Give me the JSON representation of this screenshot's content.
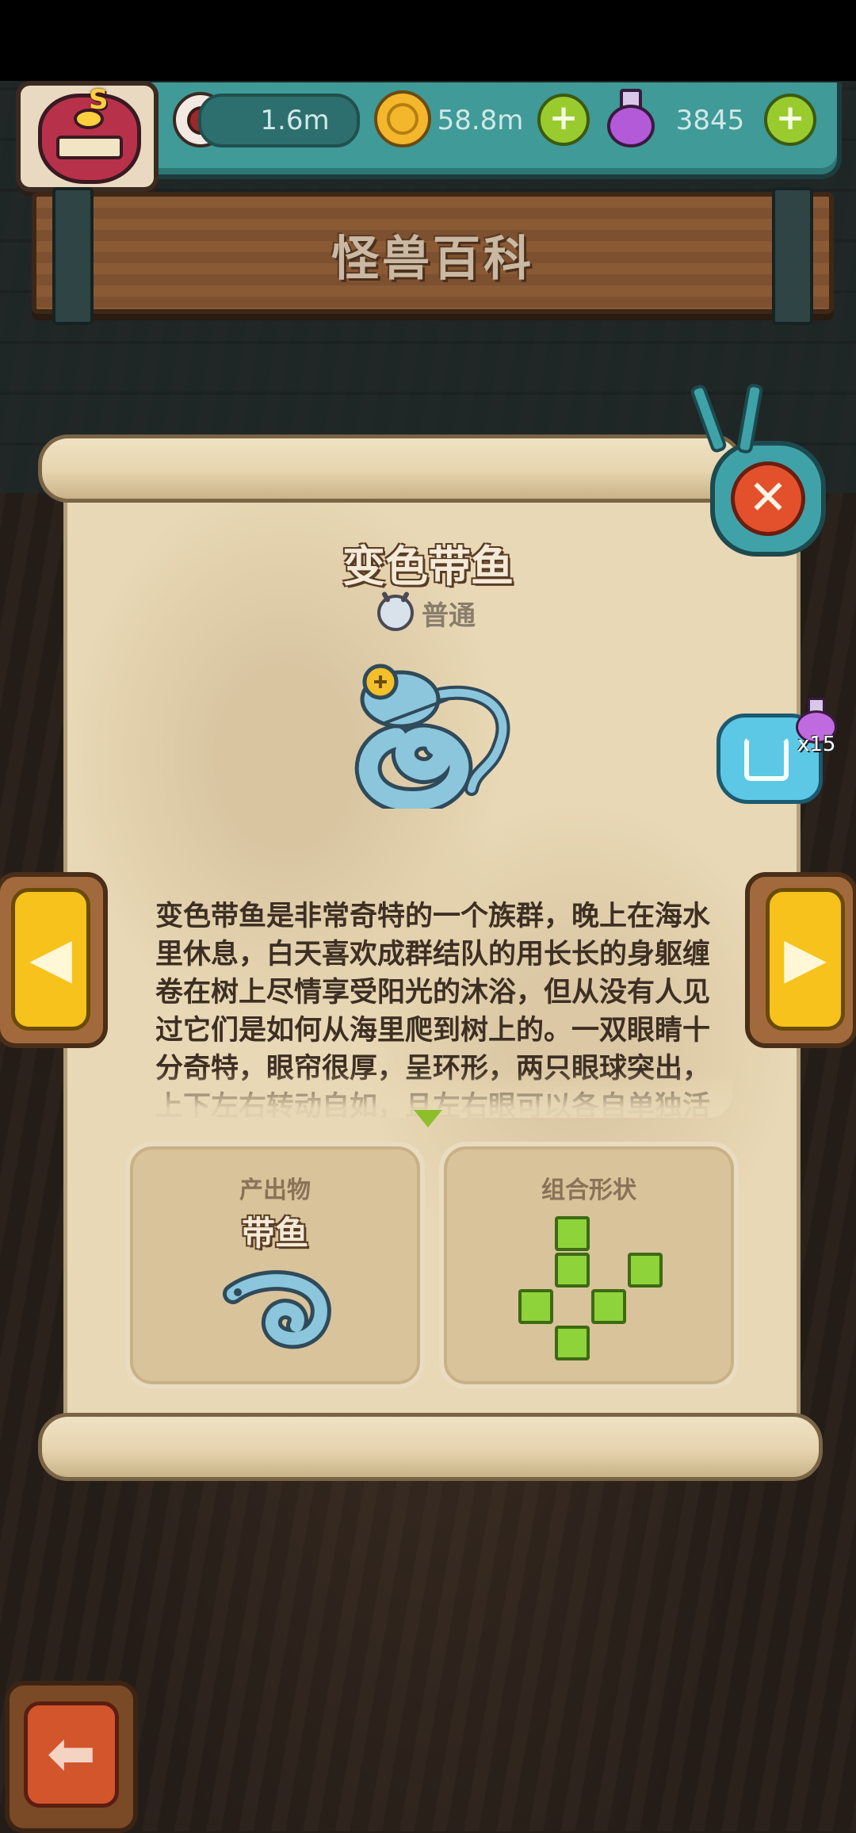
{
  "resources": {
    "eyes": "1.6m",
    "coins": "58.8m",
    "potions": "3845"
  },
  "header": {
    "avatar_badge": "S",
    "title": "怪兽百科"
  },
  "monster": {
    "name": "变色带鱼",
    "rarity": "普通",
    "description": "变色带鱼是非常奇特的一个族群，晚上在海水里休息，白天喜欢成群结队的用长长的身躯缠卷在树上尽情享受阳光的沐浴，但从没有人见过它们是如何从海里爬到树上的。一双眼睛十分奇特，眼帘很厚，呈环形，两只眼球突出，上下左右转动自如，且左右眼可以各自单独活"
  },
  "output_panel": {
    "label": "产出物",
    "value": "带鱼"
  },
  "shape_panel": {
    "label": "组合形状"
  },
  "share": {
    "count": "x15"
  },
  "buttons": {
    "plus": "+",
    "close": "✕",
    "prev": "◀",
    "next": "▶",
    "back": "⬅"
  },
  "colors": {
    "accent_teal": "#3f9a98",
    "parchment": "#e9d8b5",
    "gold_button": "#f6c21b",
    "shape_green": "#8fd33a"
  }
}
